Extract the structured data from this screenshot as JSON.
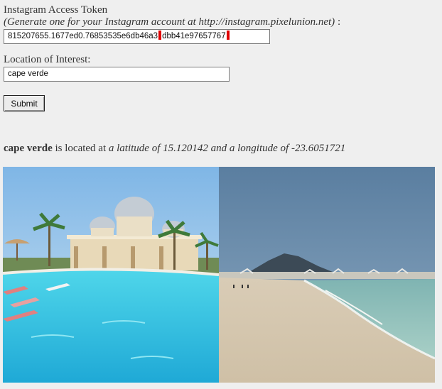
{
  "form": {
    "token_label": "Instagram Access Token",
    "token_note": "(Generate one for your Instagram account at http://instagram.pixelunion.net)",
    "token_note_suffix": " :",
    "token_value_part1": "815207655.1677ed0.76853535e6db46a3",
    "token_value_part2": "dbb41e97657767",
    "location_label": "Location of Interest:",
    "location_value": "cape verde",
    "submit_label": "Submit"
  },
  "result": {
    "place": "cape verde",
    "middle_text": " is located at ",
    "coords_text": "a latitude of 15.120142 and a longitude of -23.6051721"
  },
  "photos": [
    {
      "name": "resort-pool-photo"
    },
    {
      "name": "beach-photo"
    }
  ],
  "colors": {
    "background": "#efefef",
    "token_marker": "#e00000",
    "pool_water": "#35c8e0",
    "sky": "#5f86a8",
    "sand": "#d8cbb8"
  }
}
